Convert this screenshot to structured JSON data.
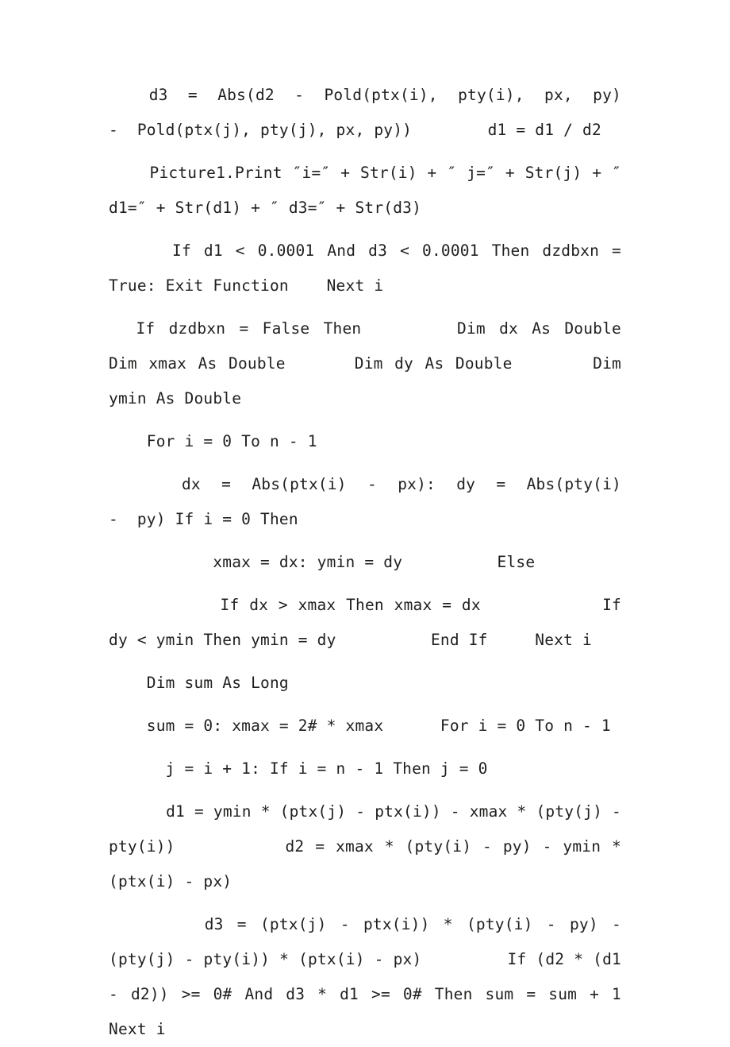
{
  "document": {
    "page_background": "#ffffff",
    "text_color": "#201f1e",
    "language": "vb6-source-listing",
    "paragraphs": [
      {
        "id": "p1",
        "text": "    d3  =  Abs(d2  -  Pold(ptx(i),  pty(i),  px,  py)  -  Pold(ptx(j), pty(j), px, py))        d1 = d1 / d2"
      },
      {
        "id": "p2",
        "text": "    Picture1.Print ″i=″ + Str(i) + ″ j=″ + Str(j) + ″  d1=″ + Str(d1) + ″ d3=″ + Str(d3)"
      },
      {
        "id": "p3",
        "text": "     If d1 < 0.0001 And d3 < 0.0001 Then dzdbxn = True: Exit Function    Next i"
      },
      {
        "id": "p4",
        "text": "  If dzdbxn = False Then       Dim dx As Double       Dim xmax As Double      Dim dy As Double       Dim ymin As Double"
      },
      {
        "id": "p5",
        "text": "    For i = 0 To n - 1"
      },
      {
        "id": "p6",
        "text": "       dx  =  Abs(ptx(i)  -  px):  dy  =  Abs(pty(i)  -  py) If i = 0 Then"
      },
      {
        "id": "p7",
        "text": "           xmax = dx: ymin = dy          Else"
      },
      {
        "id": "p8",
        "text": "           If dx > xmax Then xmax = dx            If dy < ymin Then ymin = dy          End If     Next i"
      },
      {
        "id": "p9",
        "text": "    Dim sum As Long"
      },
      {
        "id": "p10",
        "text": "    sum = 0: xmax = 2# * xmax      For i = 0 To n - 1"
      },
      {
        "id": "p11",
        "text": "      j = i + 1: If i = n - 1 Then j = 0"
      },
      {
        "id": "p12",
        "text": "      d1 = ymin * (ptx(j) - ptx(i)) - xmax * (pty(j) - pty(i))          d2 = xmax * (pty(i) - py) - ymin * (ptx(i) - px)"
      },
      {
        "id": "p13",
        "text": "       d3 = (ptx(j) - ptx(i)) * (pty(i) - py) - (pty(j) - pty(i)) * (ptx(i) - px)         If (d2 * (d1 - d2)) >= 0# And d3 * d1 >= 0# Then sum = sum + 1       Next i"
      }
    ]
  }
}
